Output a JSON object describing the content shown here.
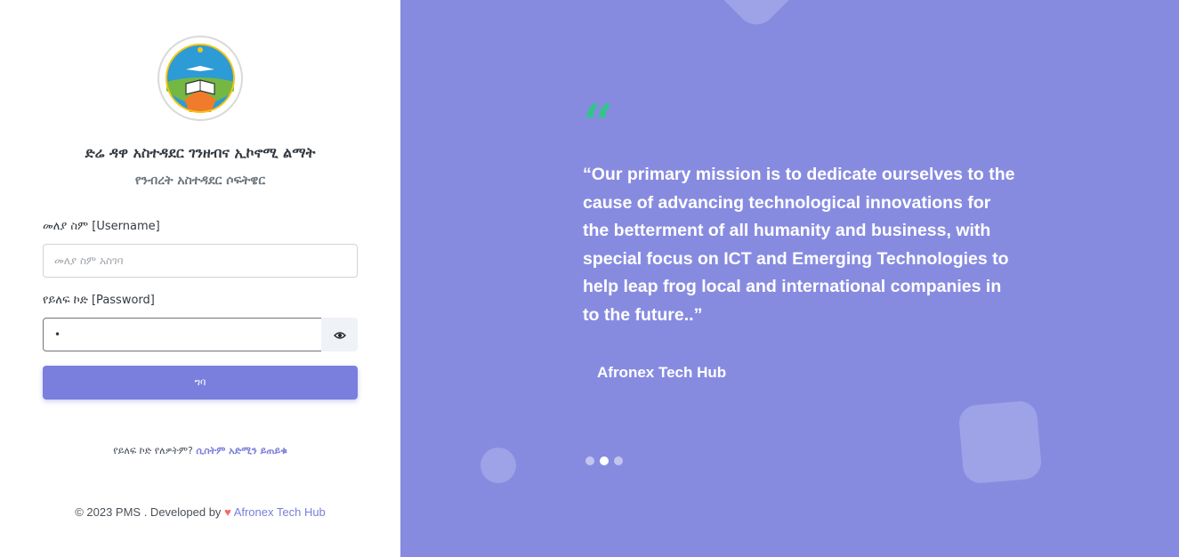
{
  "org": {
    "title": "ድሬ ዳዋ አስተዳደር ገንዘብና ኢኮኖሚ ልማት",
    "subtitle": "የንብረት አስተዳደር ሶፍትዌር"
  },
  "form": {
    "username_label": "መለያ ስም [Username]",
    "username_placeholder": "መለያ ስም አስገባ",
    "username_value": "",
    "password_label": "የይለፍ ኮድ [Password]",
    "password_value": "•",
    "submit_label": "ግባ"
  },
  "forgot": {
    "text": "የይለፍ ኮድ የለዎትም?",
    "link": "ሲስትም አድሚን ይጠይቁ"
  },
  "footer": {
    "copyright": "© 2023 PMS . Developed by",
    "heart": "♥",
    "company": "Afronex Tech Hub"
  },
  "testimonial": {
    "quote_mark": "“",
    "text": "“Our primary mission is to dedicate ourselves to the cause of advancing technological innovations for the betterment of all humanity and business, with special focus on ICT and Emerging Technologies to help leap frog local and international companies in to the future..”",
    "author": "Afronex Tech Hub",
    "slide_count": 3,
    "active_slide": 2
  },
  "colors": {
    "accent": "#7a7edc",
    "panel_bg": "#878be0",
    "quote_mark": "#34c38f",
    "heart": "#f46a6a"
  },
  "icons": {
    "show_password": "eye-icon",
    "logo": "seal-emblem"
  }
}
